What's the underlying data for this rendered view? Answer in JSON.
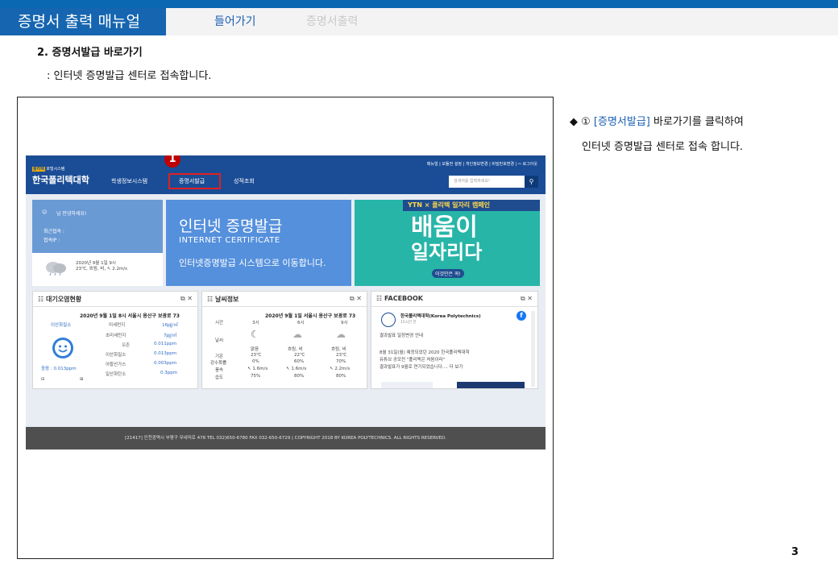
{
  "header": {
    "doc_title": "증명서 출력 매뉴얼",
    "nav_enter": "들어가기",
    "nav_print": "증명서출력"
  },
  "section": {
    "title": "2. 증명서발급 바로가기",
    "subtitle": ": 인터넷 증명발급 센터로 접속합니다."
  },
  "website": {
    "logo_tag_mark": "폴리텍",
    "logo_tag_rest": "포털시스템",
    "logo": "한국폴리텍대학",
    "menu": [
      "학생정보시스템",
      "증명서발급",
      "성적조회"
    ],
    "util_links": "메뉴얼 | 모듈전 설정 | 개인정보변경 | 비밀번호변경 | ⇨ 로그아웃",
    "search_placeholder": "검색어를 입력하세요!",
    "callout_number": "1",
    "login": {
      "greeting": "님 안녕하세요!",
      "last_access": "최근접속 :",
      "access_ip": "접속IP :",
      "weather_date": "2020년 9월 1일 9시",
      "weather_desc": "23℃, 흐림, 비, ↖ 2.2m/s"
    },
    "cert_banner": {
      "title": "인터넷 증명발급",
      "english": "INTERNET CERTIFICATE",
      "desc": "인터넷증명발급 시스템으로 이동합니다."
    },
    "ytn_banner": {
      "bar": "YTN × 폴리텍 일자리 캠페인",
      "big1": "배움이",
      "big2": "일자리다",
      "tag": "이것만은 꼭!"
    },
    "air": {
      "title": "대기오염현황",
      "caption": "2020년 9월 1일 8시 서울시 용산구 보광로 73",
      "station": "이산화질소",
      "summary": "중음 : 0.013ppm",
      "rows": [
        {
          "name": "미세먼지",
          "value": "16㎍/㎥"
        },
        {
          "name": "초미세먼지",
          "value": "7㎍/㎥"
        },
        {
          "name": "오존",
          "value": "0.011ppm"
        },
        {
          "name": "이산화질소",
          "value": "0.013ppm"
        },
        {
          "name": "아황산가스",
          "value": "0.003ppm"
        },
        {
          "name": "일산화탄소",
          "value": "0.3ppm"
        }
      ]
    },
    "weather": {
      "title": "날씨정보",
      "caption": "2020년 9월 1일 서울시 용산구 보광로 73",
      "times": [
        "시간",
        "3시",
        "6시",
        "9시"
      ],
      "row_labels": [
        "날씨",
        "기온",
        "강수확률",
        "풍속",
        "습도"
      ],
      "cols": [
        [
          "맑음",
          "23℃",
          "0%",
          "↖ 1.6m/s",
          "75%"
        ],
        [
          "흐림, 비",
          "22℃",
          "60%",
          "↖ 1.6m/s",
          "80%"
        ],
        [
          "흐림, 비",
          "23℃",
          "70%",
          "↖ 2.2m/s",
          "80%"
        ]
      ]
    },
    "facebook": {
      "title": "FACEBOOK",
      "page": "한국폴리텍대학(Korea Polytechnics)",
      "time": "15시간 전",
      "post_title": "결과발표 일정변경 안내",
      "post_body1": "8월 31일(월) 예정되었던 2020 한국폴리텍대학",
      "post_body2": "유튜브 공모전 \"폴리텍은 처음이라\"",
      "post_body3": "결과발표가 9월로 연기되었습니다.... 더 보기"
    },
    "footer": "[21417] 인천광역시 부평구 무네미로 478 TEL 032)650-6780 FAX 032-650-6729  |  COPYRIGHT 2018 BY KOREA POLYTECHNICS. ALL RIGHTS RESERVED."
  },
  "note": {
    "line1_prefix": "◆ ① ",
    "line1_link": "[증명서발급]",
    "line1_suffix": " 바로가기를 클릭하여",
    "line2": "인터넷 증명발급 센터로 접속 합니다."
  },
  "page_number": "3",
  "colors": {
    "header_blue": "#1565b0",
    "site_header": "#1b4d96",
    "highlight_red": "#e02020"
  }
}
